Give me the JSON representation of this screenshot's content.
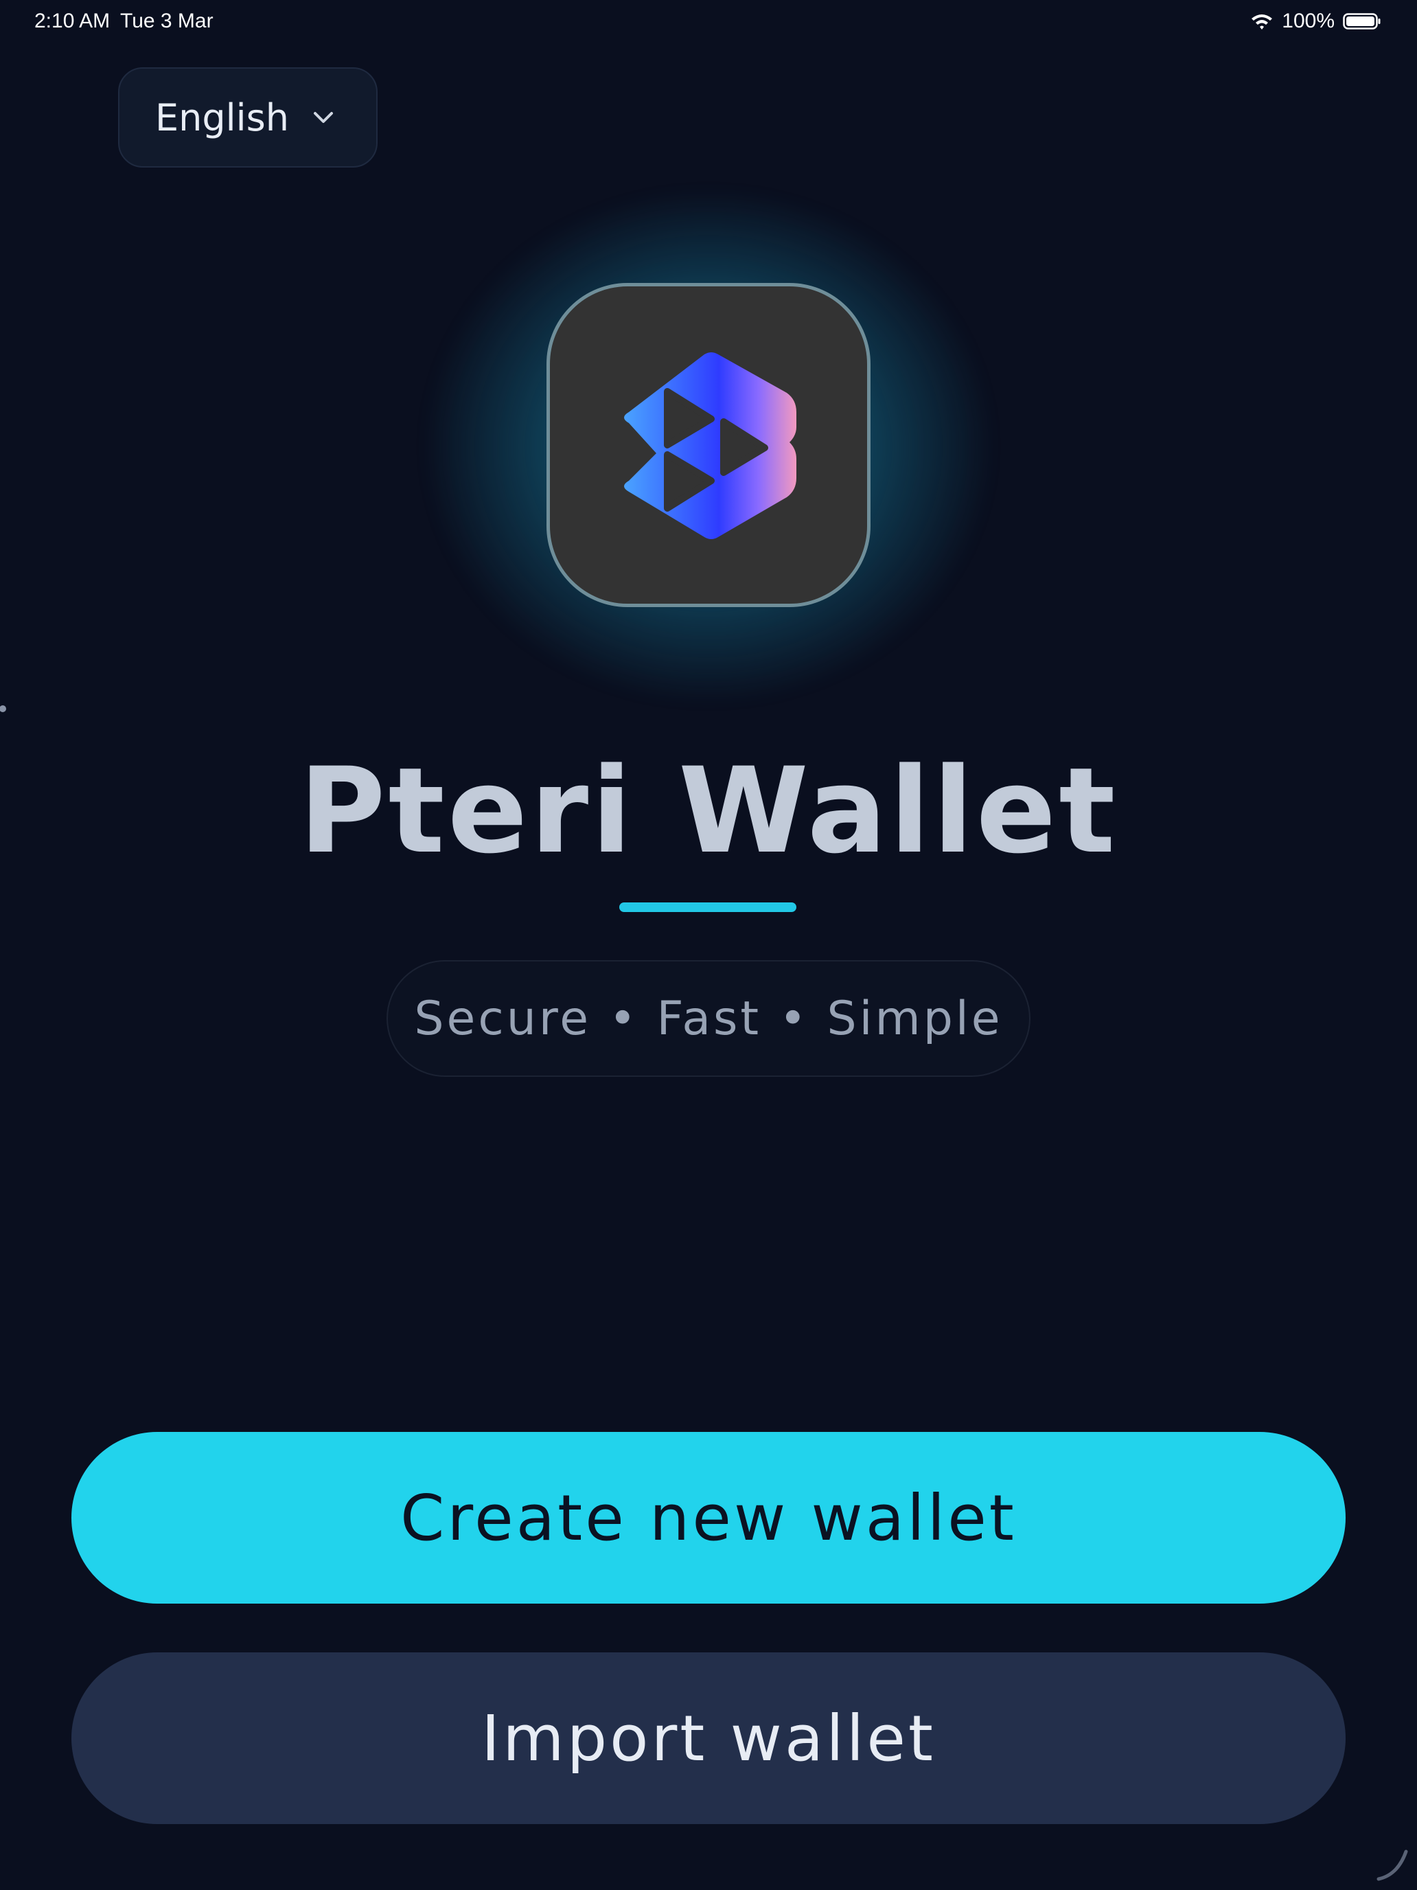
{
  "status_bar": {
    "time": "2:10 AM",
    "date": "Tue 3 Mar",
    "battery": "100%",
    "icons": [
      "wifi-icon",
      "battery-icon"
    ]
  },
  "language_selector": {
    "value": "English",
    "icon": "chevron-down-icon"
  },
  "app": {
    "logo": "pteri-logo",
    "title": "Pteri Wallet",
    "tagline": "Secure • Fast • Simple"
  },
  "actions": {
    "create_label": "Create new wallet",
    "import_label": "Import wallet"
  },
  "colors": {
    "background": "#0a0f1f",
    "accent": "#22d3ec",
    "secondary_button": "#232f4b",
    "title_text": "#c2cbd9"
  }
}
